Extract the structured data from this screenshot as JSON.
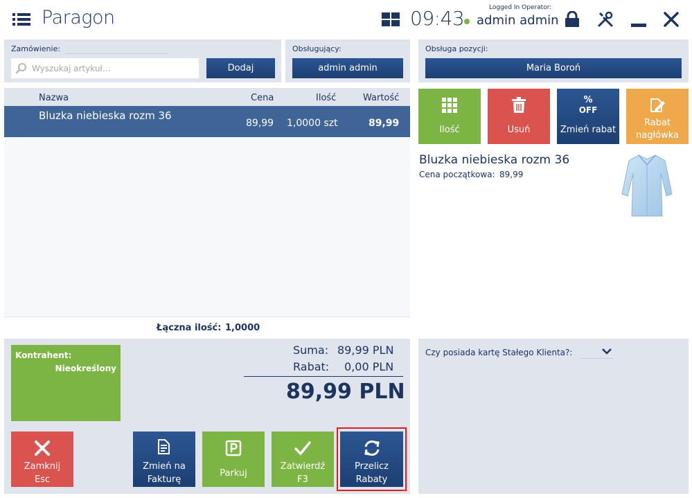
{
  "window": {
    "title": "Paragon",
    "time": "09:43",
    "operator_label": "Logged In Operator:",
    "operator_name": "admin admin",
    "icons": [
      "menu-icon",
      "tiles-icon",
      "lock-icon",
      "tools-icon",
      "minimize-icon",
      "close-icon"
    ]
  },
  "order": {
    "label": "Zamówienie:",
    "search_placeholder": "Wyszukaj artykuł...",
    "add_label": "Dodaj"
  },
  "staff": {
    "label": "Obsługujący:",
    "value": "admin admin"
  },
  "item_service": {
    "label": "Obsługa pozycji:",
    "value": "Maria Boroń"
  },
  "table": {
    "columns": [
      "Nazwa",
      "Cena",
      "Ilość",
      "Wartość"
    ],
    "rows": [
      {
        "name": "Bluzka niebieska rozm 36",
        "price": "89,99",
        "qty": "1,0000 szt",
        "value": "89,99"
      }
    ],
    "total_qty_label": "Łączna ilość:",
    "total_qty_value": "1,0000"
  },
  "contractor": {
    "label": "Kontrahent:",
    "value": "Nieokreślony",
    "color": "#7db544"
  },
  "summary": {
    "sum_label": "Suma:",
    "sum_value": "89,99 PLN",
    "discount_label": "Rabat:",
    "discount_value": "0,00 PLN",
    "total": "89,99 PLN"
  },
  "actions": {
    "close": {
      "line1": "Zamknij",
      "line2": "Esc",
      "color": "#d9534f"
    },
    "invoice": {
      "line1": "Zmień na",
      "line2": "Fakturę"
    },
    "park": {
      "label": "Parkuj"
    },
    "confirm": {
      "line1": "Zatwierdź",
      "line2": "F3"
    },
    "recalc": {
      "line1": "Przelicz",
      "line2": "Rabaty"
    }
  },
  "tiles": {
    "qty": {
      "label": "Ilość",
      "color": "#7db544"
    },
    "delete": {
      "label": "Usuń",
      "color": "#d9534f"
    },
    "change_discount": {
      "label": "Zmień rabat",
      "icon_text": "%",
      "icon_sub": "OFF"
    },
    "header_discount": {
      "line1": "Rabat",
      "line2": "nagłówka",
      "color": "#f0a94a"
    }
  },
  "product": {
    "name": "Bluzka niebieska rozm 36",
    "start_price_label": "Cena początkowa:",
    "start_price_value": "89,99"
  },
  "loyalty": {
    "question": "Czy posiada kartę Stałego Klienta?:"
  }
}
